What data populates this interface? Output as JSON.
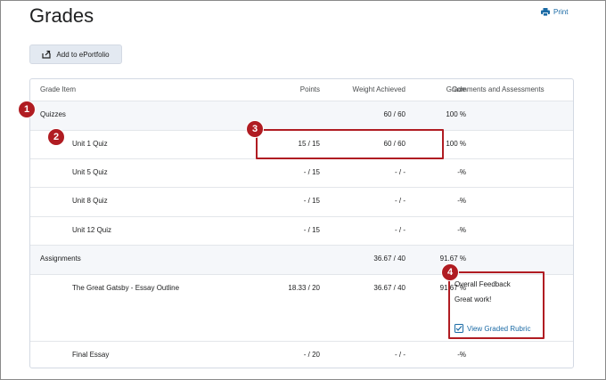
{
  "page": {
    "title": "Grades",
    "print_label": "Print",
    "eportfolio_label": "Add to ePortfolio"
  },
  "table": {
    "headers": {
      "item": "Grade Item",
      "points": "Points",
      "weight": "Weight Achieved",
      "grade": "Grade",
      "comments": "Comments and Assessments"
    },
    "rows": [
      {
        "item": "Quizzes",
        "points": "",
        "weight": "60 / 60",
        "grade": "100 %"
      },
      {
        "item": "Unit 1 Quiz",
        "points": "15 / 15",
        "weight": "60 / 60",
        "grade": "100 %"
      },
      {
        "item": "Unit 5 Quiz",
        "points": "- / 15",
        "weight": "- / -",
        "grade": "-%"
      },
      {
        "item": "Unit 8 Quiz",
        "points": "- / 15",
        "weight": "- / -",
        "grade": "-%"
      },
      {
        "item": "Unit 12 Quiz",
        "points": "- / 15",
        "weight": "- / -",
        "grade": "-%"
      },
      {
        "item": "Assignments",
        "points": "",
        "weight": "36.67 / 40",
        "grade": "91.67 %"
      },
      {
        "item": "The Great Gatsby - Essay Outline",
        "points": "18.33 / 20",
        "weight": "36.67 / 40",
        "grade": "91.67 %"
      },
      {
        "item": "Final Essay",
        "points": "- / 20",
        "weight": "- / -",
        "grade": "-%"
      }
    ],
    "feedback": {
      "title": "Overall Feedback",
      "text": "Great work!",
      "rubric_link": "View Graded Rubric"
    }
  },
  "callouts": [
    "1",
    "2",
    "3",
    "4"
  ],
  "colors": {
    "callout": "#b01c22",
    "link": "#1a6aa5",
    "button_bg": "#e3e9f1",
    "category_bg": "#f5f7fa"
  }
}
